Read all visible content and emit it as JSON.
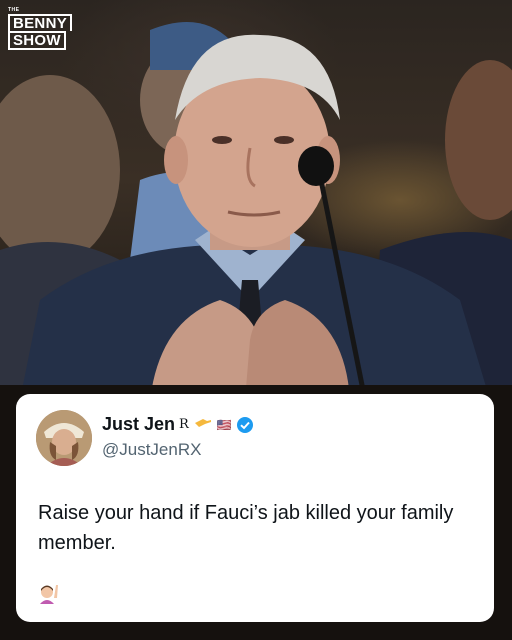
{
  "logo": {
    "small": "THE",
    "line1": "BENNY",
    "line2": "SHOW"
  },
  "tweet": {
    "display_name": "Just Jen",
    "name_badges": "R",
    "flag_emoji": "🇺🇸",
    "handle": "@JustJenRX",
    "text": "Raise your hand if Fauci’s jab killed your family member.",
    "trailing_emoji": "🙋‍♀️",
    "verified_color": "#1d9bf0"
  }
}
